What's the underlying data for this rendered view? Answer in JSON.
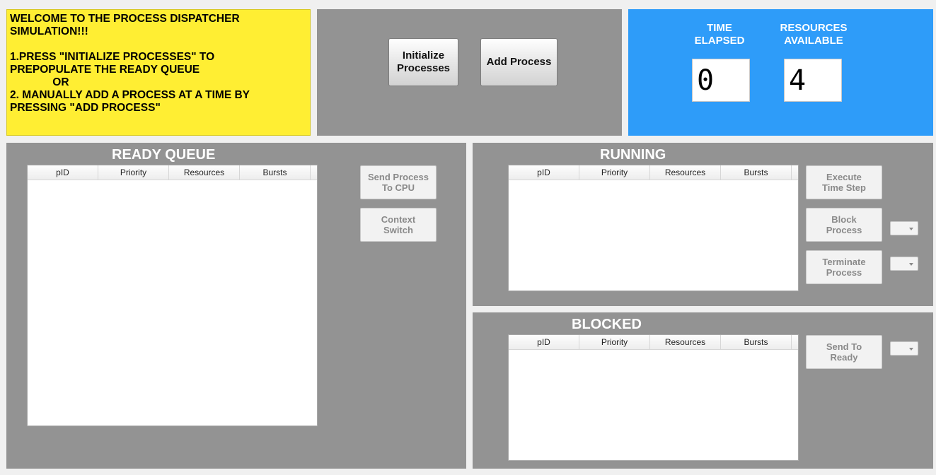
{
  "welcome": {
    "text": "WELCOME TO THE PROCESS DISPATCHER\nSIMULATION!!!\n\n1.PRESS \"INITIALIZE PROCESSES\" TO\nPREPOPULATE THE READY QUEUE\n              OR\n2. MANUALLY ADD A PROCESS AT A TIME BY\nPRESSING \"ADD PROCESS\""
  },
  "controls": {
    "initialize_label": "Initialize\nProcesses",
    "add_label": "Add Process"
  },
  "stats": {
    "time_label": "TIME\nELAPSED",
    "time_value": "0",
    "resources_label": "RESOURCES\nAVAILABLE",
    "resources_value": "4"
  },
  "columns": [
    "pID",
    "Priority",
    "Resources",
    "Bursts"
  ],
  "ready": {
    "title": "READY QUEUE",
    "send_label": "Send Process\nTo CPU",
    "context_label": "Context\nSwitch",
    "rows": []
  },
  "running": {
    "title": "RUNNING",
    "execute_label": "Execute\nTime Step",
    "block_label": "Block\nProcess",
    "terminate_label": "Terminate\nProcess",
    "rows": []
  },
  "blocked": {
    "title": "BLOCKED",
    "send_ready_label": "Send To\nReady",
    "rows": []
  },
  "colors": {
    "welcome_bg": "#ffee33",
    "panel_grey": "#939393",
    "stats_blue": "#2e9cf9"
  },
  "icons": {
    "dropdown": "chevron-down-icon"
  }
}
